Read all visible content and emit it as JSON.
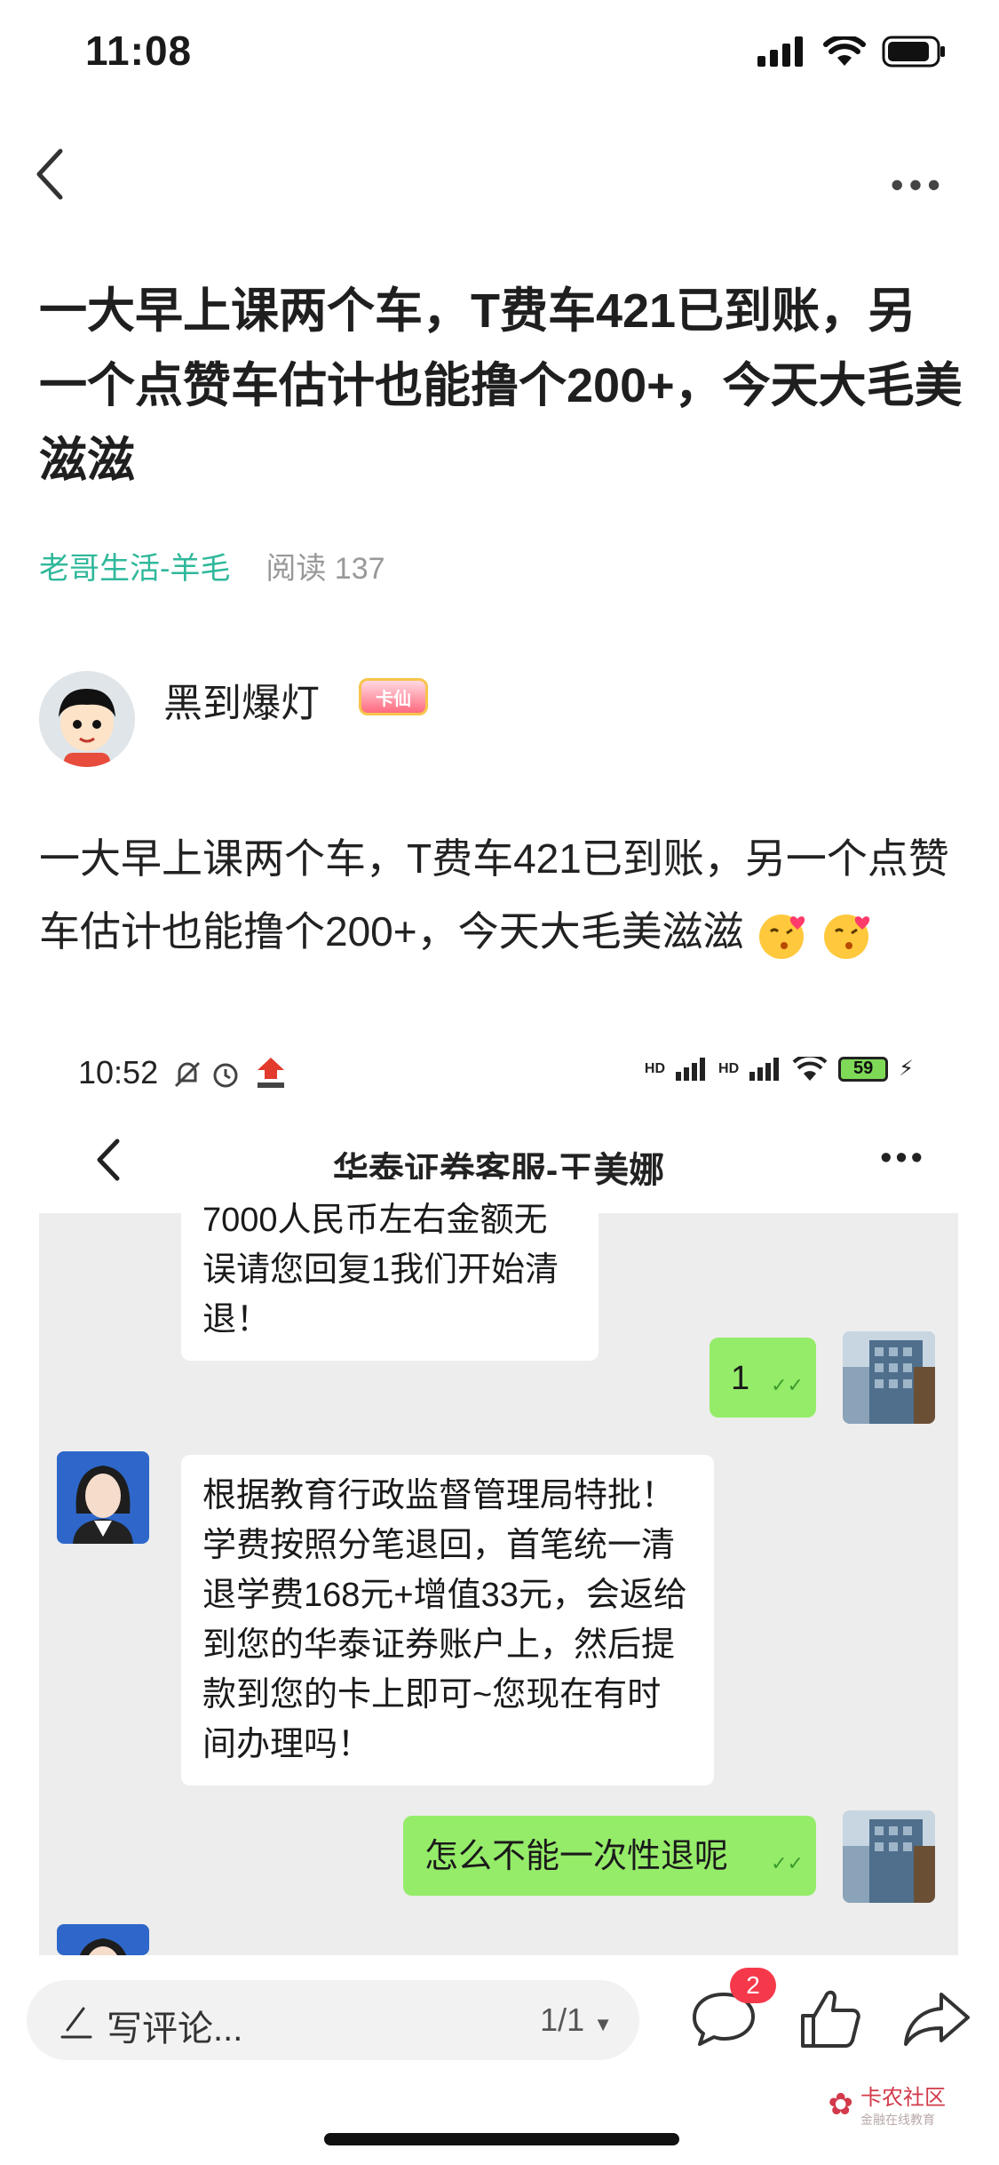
{
  "status_bar": {
    "time": "11:08"
  },
  "post": {
    "title": "一大早上课两个车，T费车421已到账，另一个点赞车估计也能撸个200+，今天大毛美滋滋",
    "channel": "老哥生活-羊毛",
    "read_label": "阅读",
    "read_count": "137",
    "body": "一大早上课两个车，T费车421已到账，另一个点赞车估计也能撸个200+，今天大毛美滋滋"
  },
  "author": {
    "name": "黑到爆灯",
    "badge": "卡仙"
  },
  "embedded_screenshot": {
    "status_time": "10:52",
    "signal_label_1": "HD",
    "signal_label_2": "HD",
    "battery": "59",
    "title": "华泰证券客服-王美娜",
    "messages": [
      {
        "from": "agent",
        "text": "7000人民币左右金额无误请您回复1我们开始清退！"
      },
      {
        "from": "user",
        "text": "1"
      },
      {
        "from": "agent",
        "text": "根据教育行政监督管理局特批！学费按照分笔退回，首笔统一清退学费168元+增值33元，会返给到您的华泰证券账户上，然后提款到您的卡上即可~您现在有时间办理吗！"
      },
      {
        "from": "user",
        "text": "怎么不能一次性退呢"
      }
    ]
  },
  "bottom_bar": {
    "comment_placeholder": "写评论...",
    "page_indicator": "1/1",
    "comment_count": "2"
  },
  "watermark": {
    "name": "卡农社区",
    "tagline": "金融在线教育"
  },
  "colors": {
    "accent": "#2fb89a",
    "bubble_out": "#95ec69",
    "badge_red": "#f5394b"
  }
}
